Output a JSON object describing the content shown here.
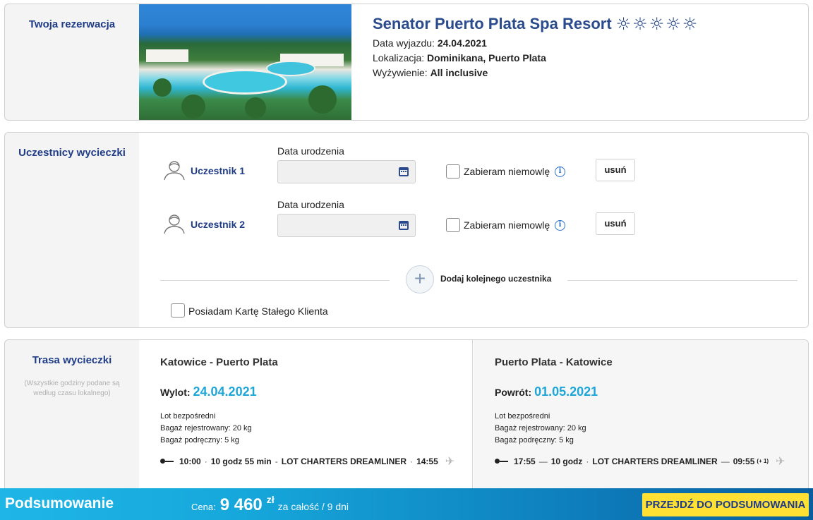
{
  "reservation": {
    "label": "Twoja rezerwacja",
    "hotel_name": "Senator Puerto Plata Spa Resort",
    "stars_icon": "sun-icon",
    "stars_count": 5,
    "departure_label": "Data wyjazdu:",
    "departure_value": "24.04.2021",
    "location_label": "Lokalizacja:",
    "location_value": "Dominikana, Puerto Plata",
    "board_label": "Wyżywienie:",
    "board_value": "All inclusive"
  },
  "participants": {
    "label": "Uczestnicy wycieczki",
    "items": [
      {
        "name": "Uczestnik 1",
        "dob_label": "Data urodzenia",
        "dob_value": "",
        "infant_label": "Zabieram niemowlę",
        "remove_label": "usuń"
      },
      {
        "name": "Uczestnik 2",
        "dob_label": "Data urodzenia",
        "dob_value": "",
        "infant_label": "Zabieram niemowlę",
        "remove_label": "usuń"
      }
    ],
    "add_label": "Dodaj kolejnego uczestnika",
    "club_card_label": "Posiadam Kartę Stałego Klienta"
  },
  "route": {
    "label": "Trasa wycieczki",
    "timezone_note": "(Wszystkie godziny podane są według czasu lokalnego)",
    "outbound": {
      "title": "Katowice - Puerto Plata",
      "date_label": "Wylot:",
      "date_value": "24.04.2021",
      "flight_type": "Lot bezpośredni",
      "checked_bag": "Bagaż rejestrowany: 20 kg",
      "hand_bag": "Bagaż podręczny: 5 kg",
      "dep_time": "10:00",
      "duration": "10 godz 55 min",
      "carrier": "LOT CHARTERS DREAMLINER",
      "arr_time": "14:55",
      "arr_offset": ""
    },
    "return": {
      "title": "Puerto Plata - Katowice",
      "date_label": "Powrót:",
      "date_value": "01.05.2021",
      "flight_type": "Lot bezpośredni",
      "checked_bag": "Bagaż rejestrowany: 20 kg",
      "hand_bag": "Bagaż podręczny: 5 kg",
      "dep_time": "17:55",
      "duration": "10 godz",
      "carrier": "LOT CHARTERS DREAMLINER",
      "arr_time": "09:55",
      "arr_offset": "(+ 1)"
    }
  },
  "summary": {
    "title": "Podsumowanie",
    "price_label": "Cena:",
    "price_value": "9 460",
    "currency": "zł",
    "price_note": "za całość / 9 dni",
    "cta_label": "PRZEJDŹ DO PODSUMOWANIA"
  },
  "colors": {
    "brand_navy": "#1f3c88",
    "accent_cyan": "#1fa6d8",
    "cta_yellow": "#ffe033"
  }
}
